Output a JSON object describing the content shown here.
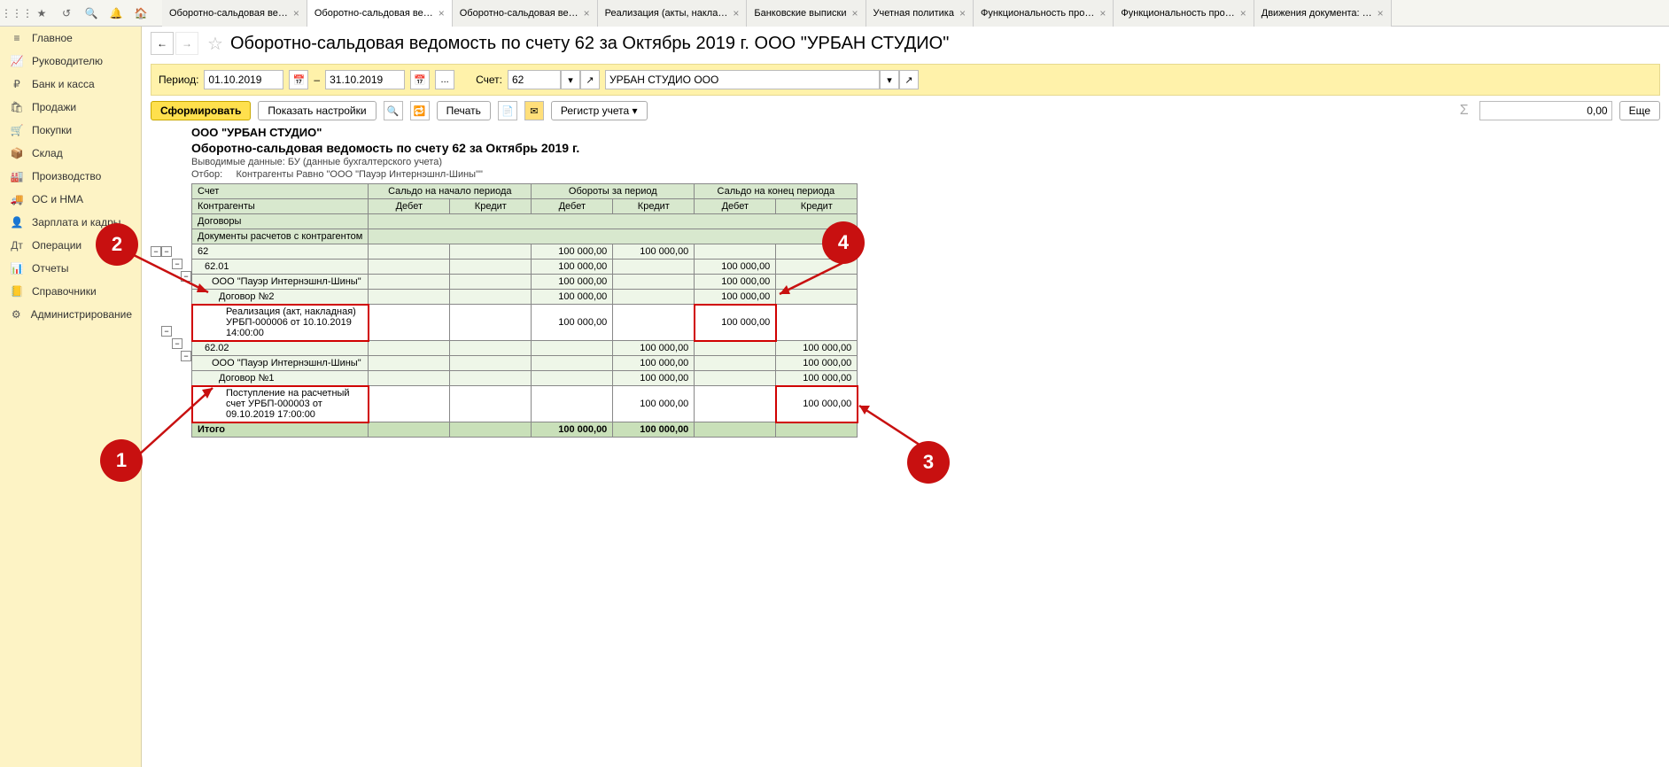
{
  "top_icons": [
    "apps",
    "star",
    "history",
    "search",
    "bell",
    "home"
  ],
  "tabs": [
    {
      "label": "Оборотно-сальдовая ве…",
      "active": false
    },
    {
      "label": "Оборотно-сальдовая ве…",
      "active": true
    },
    {
      "label": "Оборотно-сальдовая ве…",
      "active": false
    },
    {
      "label": "Реализация (акты, накла…",
      "active": false
    },
    {
      "label": "Банковские выписки",
      "active": false
    },
    {
      "label": "Учетная политика",
      "active": false
    },
    {
      "label": "Функциональность про…",
      "active": false
    },
    {
      "label": "Функциональность про…",
      "active": false
    },
    {
      "label": "Движения документа: …",
      "active": false
    }
  ],
  "sidebar": [
    {
      "icon": "≡",
      "label": "Главное"
    },
    {
      "icon": "📈",
      "label": "Руководителю"
    },
    {
      "icon": "₽",
      "label": "Банк и касса"
    },
    {
      "icon": "🛍",
      "label": "Продажи"
    },
    {
      "icon": "🛒",
      "label": "Покупки"
    },
    {
      "icon": "📦",
      "label": "Склад"
    },
    {
      "icon": "🏭",
      "label": "Производство"
    },
    {
      "icon": "🚚",
      "label": "ОС и НМА"
    },
    {
      "icon": "👤",
      "label": "Зарплата и кадры"
    },
    {
      "icon": "Дт",
      "label": "Операции"
    },
    {
      "icon": "📊",
      "label": "Отчеты"
    },
    {
      "icon": "📒",
      "label": "Справочники"
    },
    {
      "icon": "⚙",
      "label": "Администрирование"
    }
  ],
  "page_title": "Оборотно-сальдовая ведомость по счету 62 за Октябрь 2019 г. ООО \"УРБАН СТУДИО\"",
  "filter": {
    "period_label": "Период:",
    "from": "01.10.2019",
    "to": "31.10.2019",
    "dash": "–",
    "ellipsis": "...",
    "account_label": "Счет:",
    "account": "62",
    "org": "УРБАН СТУДИО ООО"
  },
  "actions": {
    "generate": "Сформировать",
    "settings": "Показать настройки",
    "print": "Печать",
    "registry": "Регистр учета ▾",
    "sum": "0,00",
    "more": "Еще"
  },
  "report": {
    "company": "ООО \"УРБАН СТУДИО\"",
    "title": "Оборотно-сальдовая ведомость по счету 62 за Октябрь 2019 г.",
    "meta1_label": "Выводимые данные:",
    "meta1_val": "БУ (данные бухгалтерского учета)",
    "meta2_label": "Отбор:",
    "meta2_val": "Контрагенты Равно \"ООО \"Пауэр Интернэшнл-Шины\"\"",
    "col_account": "Счет",
    "col_contr": "Контрагенты",
    "col_dogov": "Договоры",
    "col_docs": "Документы расчетов с контрагентом",
    "grp_start": "Сальдо на начало периода",
    "grp_turn": "Обороты за период",
    "grp_end": "Сальдо на конец периода",
    "dt": "Дебет",
    "kt": "Кредит",
    "rows": {
      "r62": "62",
      "r6201": "62.01",
      "rpower1": "ООО \"Пауэр Интернэшнл-Шины\"",
      "rdog2": "Договор №2",
      "rdoc1": "Реализация (акт, накладная) УРБП-000006 от 10.10.2019 14:00:00",
      "r6202": "62.02",
      "rpower2": "ООО \"Пауэр Интернэшнл-Шины\"",
      "rdog1": "Договор №1",
      "rdoc2": "Поступление на расчетный счет УРБП-000003 от 09.10.2019 17:00:00",
      "totals": "Итого"
    },
    "v100": "100 000,00"
  },
  "annotations": {
    "a1": "1",
    "a2": "2",
    "a3": "3",
    "a4": "4"
  }
}
